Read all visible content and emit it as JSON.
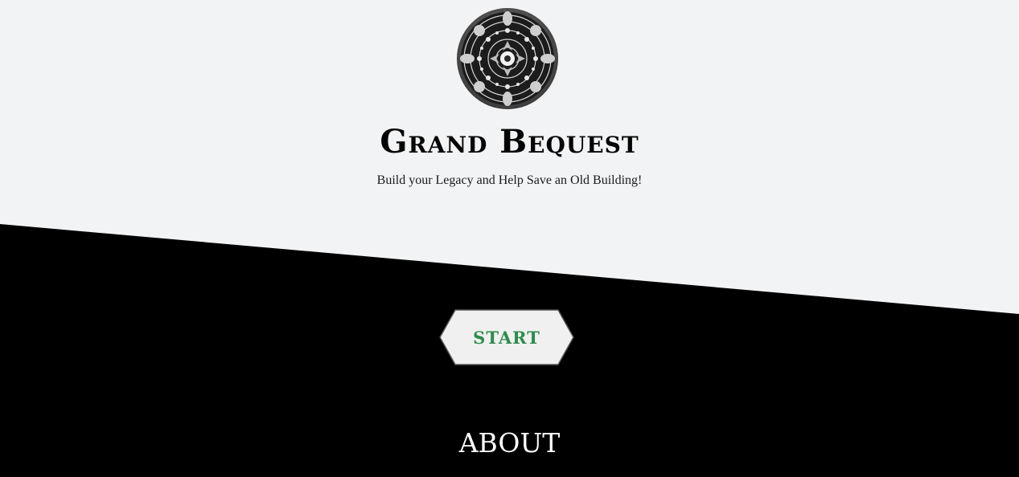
{
  "header": {
    "logo_icon": "ornate-mandala-logo-icon",
    "title": "Grand Bequest",
    "tagline": "Build your Legacy and Help Save an Old Building!"
  },
  "hero": {
    "start_label": "START"
  },
  "about": {
    "heading": "ABOUT"
  },
  "colors": {
    "page_background": "#f2f3f5",
    "dark_band": "#000000",
    "start_text": "#2e8b4c",
    "start_fill": "#f0f0f0",
    "about_text": "#ffffff"
  }
}
